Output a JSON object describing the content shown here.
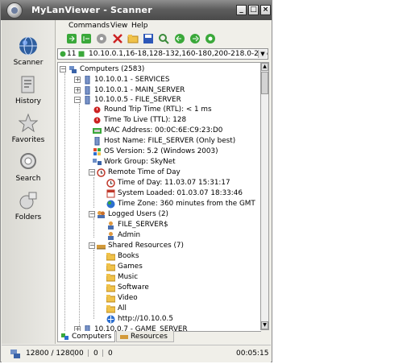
{
  "window": {
    "title": "MyLanViewer - Scanner"
  },
  "sidebar": {
    "items": [
      {
        "label": "Scanner",
        "icon": "globe-icon"
      },
      {
        "label": "History",
        "icon": "history-icon"
      },
      {
        "label": "Favorites",
        "icon": "star-icon"
      },
      {
        "label": "Search",
        "icon": "search-icon"
      },
      {
        "label": "Folders",
        "icon": "folders-icon"
      }
    ]
  },
  "menu": {
    "items": [
      "Commands",
      "View",
      "Help"
    ]
  },
  "address": {
    "value": "10.10.0.1,16-18,128-132,160-180,200-218.0-255",
    "left_digits": "11"
  },
  "tree": {
    "root": "Computers (2583)",
    "n1": "10.10.0.1 - SERVICES",
    "n2": "10.10.0.1 - MAIN_SERVER",
    "n3": "10.10.0.5 - FILE_SERVER",
    "rtt": "Round Trip Time (RTL): < 1 ms",
    "ttl": "Time To Live (TTL): 128",
    "mac": "MAC Address: 00:0C:6E:C9:23:D0",
    "host": "Host Name: FILE_SERVER (Only best)",
    "os": "OS Version: 5.2 (Windows 2003)",
    "workgroup": "Work Group: SkyNet",
    "rtod": "Remote Time of Day",
    "tod": "Time of Day: 11.03.07 15:31:17",
    "loaded": "System Loaded: 01.03.07 18:33:46",
    "tz": "Time Zone: 360 minutes from the GMT",
    "logged": "Logged Users (2)",
    "user1": "FILE_SERVER$",
    "user2": "Admin",
    "shared": "Shared Resources (7)",
    "sr1": "Books",
    "sr2": "Games",
    "sr3": "Music",
    "sr4": "Software",
    "sr5": "Video",
    "sr6": "All",
    "sr7": "http://10.10.0.5",
    "n4": "10.10.0.7 - GAME_SERVER"
  },
  "tabs": {
    "computers": "Computers",
    "resources": "Resources"
  },
  "status": {
    "count": "12800 / 12800",
    "a": "0",
    "b": "0",
    "c": "0",
    "time": "00:05:15"
  },
  "colors": {
    "title_bg": "#5d5d5d",
    "folder": "#f0c24a",
    "green": "#3aa83a",
    "red": "#cc2222"
  }
}
